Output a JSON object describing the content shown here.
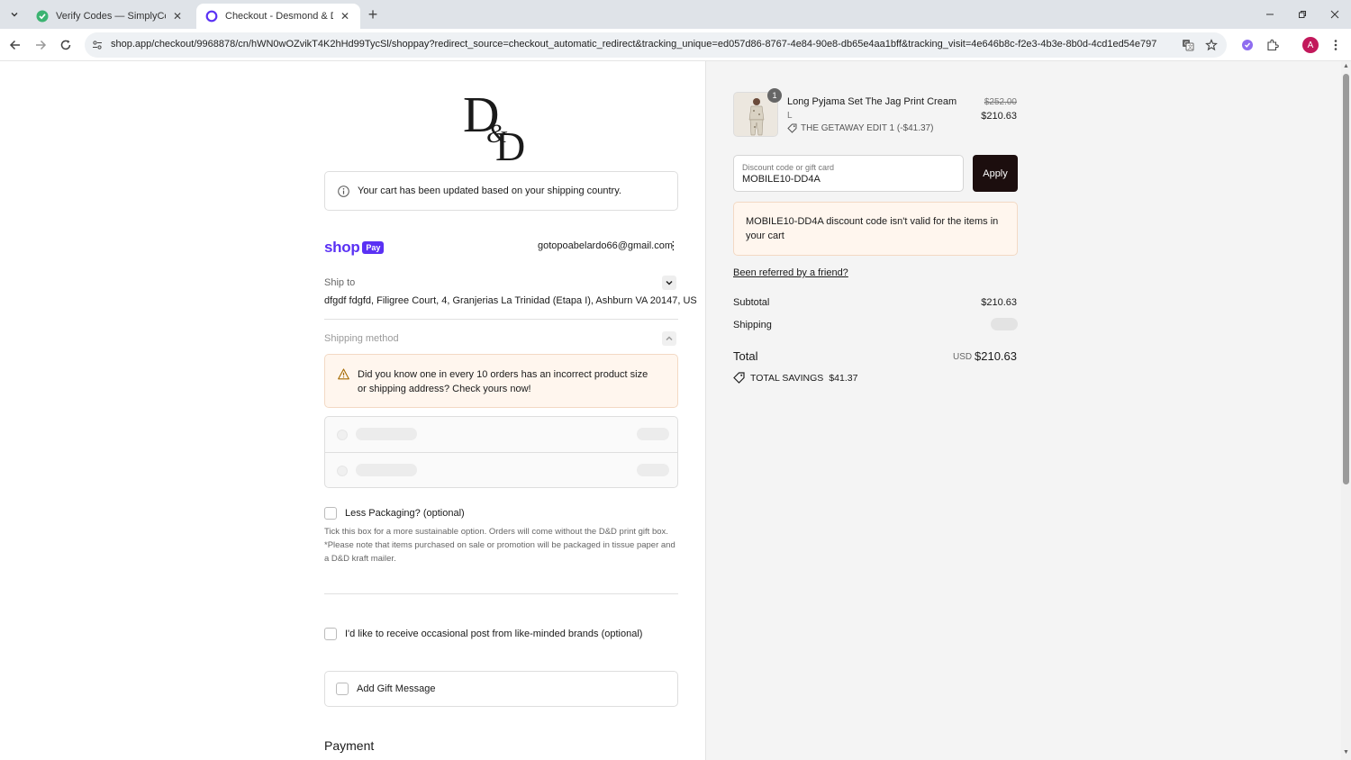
{
  "browser": {
    "tabs": [
      {
        "title": "Verify Codes — SimplyCodes",
        "active": false
      },
      {
        "title": "Checkout - Desmond & Demps",
        "active": true
      }
    ],
    "url": "shop.app/checkout/9968878/cn/hWN0wOZvikT4K2hHd99TycSl/shoppay?redirect_source=checkout_automatic_redirect&tracking_unique=ed057d86-8767-4e84-90e8-db65e4aa1bff&tracking_visit=4e646b8c-f2e3-4b3e-8b0d-4cd1ed54e797",
    "profile_initial": "A",
    "accent": "#c2185b"
  },
  "checkout": {
    "cart_notice": "Your cart has been updated based on your shipping country.",
    "shop_pay": {
      "shop": "shop",
      "pay": "Pay",
      "email": "gotopoabelardo66@gmail.com",
      "brand_color": "#5a31f4"
    },
    "ship_to_label": "Ship to",
    "ship_address": "dfgdf fdgfd, Filigree Court, 4, Granjerias La Trinidad (Etapa I), Ashburn VA 20147, US",
    "shipping_method_label": "Shipping method",
    "shipping_warning": "Did you know one in every 10 orders has an incorrect product size or shipping address? Check yours now!",
    "less_packaging_label": "Less Packaging? (optional)",
    "less_packaging_note": "Tick this box for a more sustainable option. Orders will come without the D&D print gift box. *Please note that items purchased on sale or promotion will be packaged in tissue paper and a D&D kraft mailer.",
    "post_optin_label": "I'd like to receive occasional post from like-minded brands (optional)",
    "gift_message_label": "Add Gift Message",
    "payment_heading": "Payment"
  },
  "summary": {
    "product": {
      "name": "Long Pyjama Set The Jag Print Cream",
      "variant": "L",
      "quantity": "1",
      "discount": "THE GETAWAY EDIT 1 (-$41.37)",
      "price_original": "$252.00",
      "price_final": "$210.63"
    },
    "discount_placeholder": "Discount code or gift card",
    "discount_value": "MOBILE10-DD4A",
    "apply_label": "Apply",
    "error_message": "MOBILE10-DD4A discount code isn't valid for the items in your cart",
    "referral_link": "Been referred by a friend?",
    "subtotal_label": "Subtotal",
    "subtotal_value": "$210.63",
    "shipping_label": "Shipping",
    "total_label": "Total",
    "total_currency": "USD",
    "total_value": "$210.63",
    "savings_label": "TOTAL SAVINGS",
    "savings_value": "$41.37"
  }
}
